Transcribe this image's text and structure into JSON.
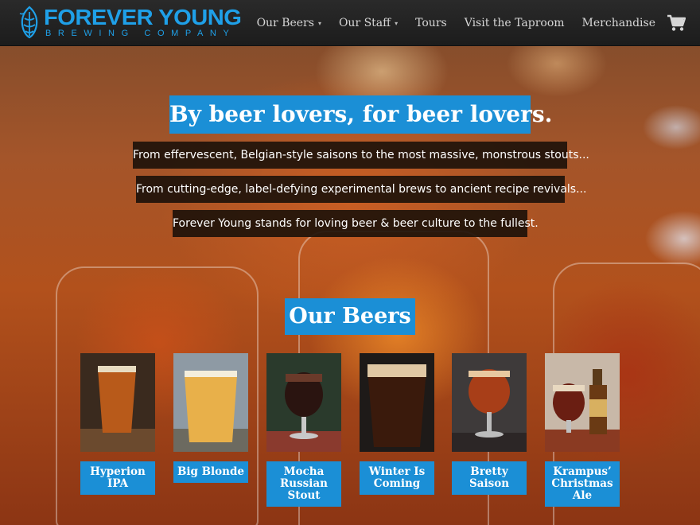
{
  "brand": {
    "name": "FOREVER YOUNG",
    "subtitle": "BREWING COMPANY",
    "accent": "#1fa0e8",
    "logo_icon": "hop-icon"
  },
  "nav": {
    "items": [
      {
        "label": "Our Beers",
        "dropdown": true
      },
      {
        "label": "Our Staff",
        "dropdown": true
      },
      {
        "label": "Tours",
        "dropdown": false
      },
      {
        "label": "Visit the Taproom",
        "dropdown": false
      },
      {
        "label": "Merchandise",
        "dropdown": false
      }
    ],
    "cart_icon": "cart-icon"
  },
  "hero": {
    "headline": "By beer lovers, for beer lovers.",
    "lines": [
      "From effervescent, Belgian-style saisons to the most massive, monstrous stouts...",
      "From cutting-edge, label-defying experimental brews to ancient recipe revivals...",
      "Forever Young stands for loving beer & beer culture to the fullest."
    ]
  },
  "beers": {
    "title": "Our Beers",
    "items": [
      {
        "name": "Hyperion IPA",
        "color": "#b85a1a"
      },
      {
        "name": "Big Blonde",
        "color": "#e8b04a"
      },
      {
        "name": "Mocha Russian Stout",
        "color": "#2a1410"
      },
      {
        "name": "Winter Is Coming",
        "color": "#3a1a0c"
      },
      {
        "name": "Bretty Saison",
        "color": "#a83e18"
      },
      {
        "name": "Krampus’ Christmas Ale",
        "color": "#6a1e12"
      }
    ]
  }
}
